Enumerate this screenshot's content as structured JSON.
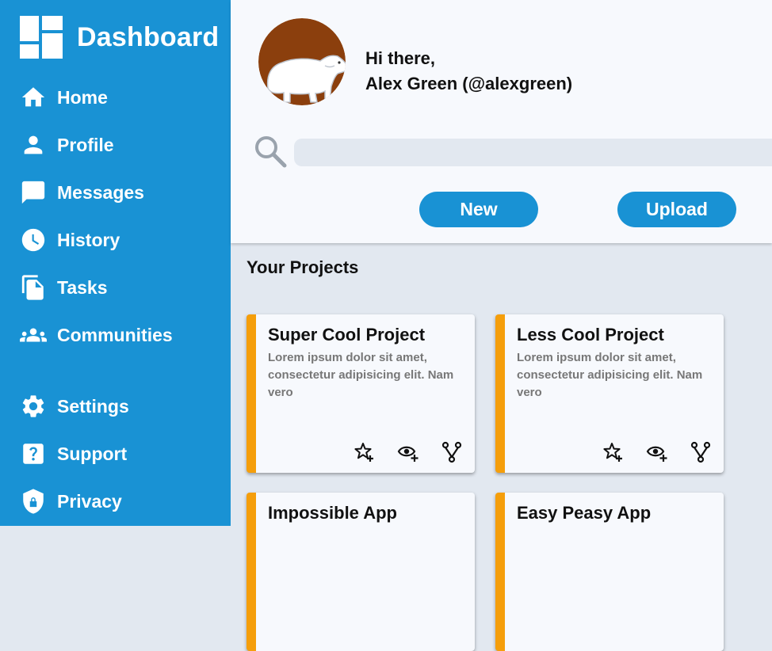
{
  "sidebar": {
    "brand_title": "Dashboard",
    "items": [
      {
        "label": "Home",
        "icon": "home-icon"
      },
      {
        "label": "Profile",
        "icon": "user-icon"
      },
      {
        "label": "Messages",
        "icon": "message-icon"
      },
      {
        "label": "History",
        "icon": "clock-icon"
      },
      {
        "label": "Tasks",
        "icon": "document-icon"
      },
      {
        "label": "Communities",
        "icon": "group-icon"
      },
      {
        "label": "Settings",
        "icon": "gear-icon"
      },
      {
        "label": "Support",
        "icon": "help-icon"
      },
      {
        "label": "Privacy",
        "icon": "shield-lock-icon"
      }
    ]
  },
  "header": {
    "greeting_line1": "Hi there,",
    "greeting_line2": "Alex Green (@alexgreen)",
    "search_placeholder": "",
    "new_label": "New",
    "upload_label": "Upload"
  },
  "main": {
    "section_title": "Your Projects",
    "projects": [
      {
        "title": "Super Cool Project",
        "description": "Lorem ipsum dolor sit amet, consectetur adipisicing elit. Nam vero"
      },
      {
        "title": "Less Cool Project",
        "description": "Lorem ipsum dolor sit amet, consectetur adipisicing elit. Nam vero"
      },
      {
        "title": "Impossible App",
        "description": ""
      },
      {
        "title": "Easy Peasy App",
        "description": ""
      }
    ]
  },
  "colors": {
    "sidebar_bg": "#1992d4",
    "accent": "#f59e0b",
    "header_bg": "#f7f9fd",
    "main_bg": "#e2e8f0",
    "avatar_bg": "#8b3f0d"
  }
}
